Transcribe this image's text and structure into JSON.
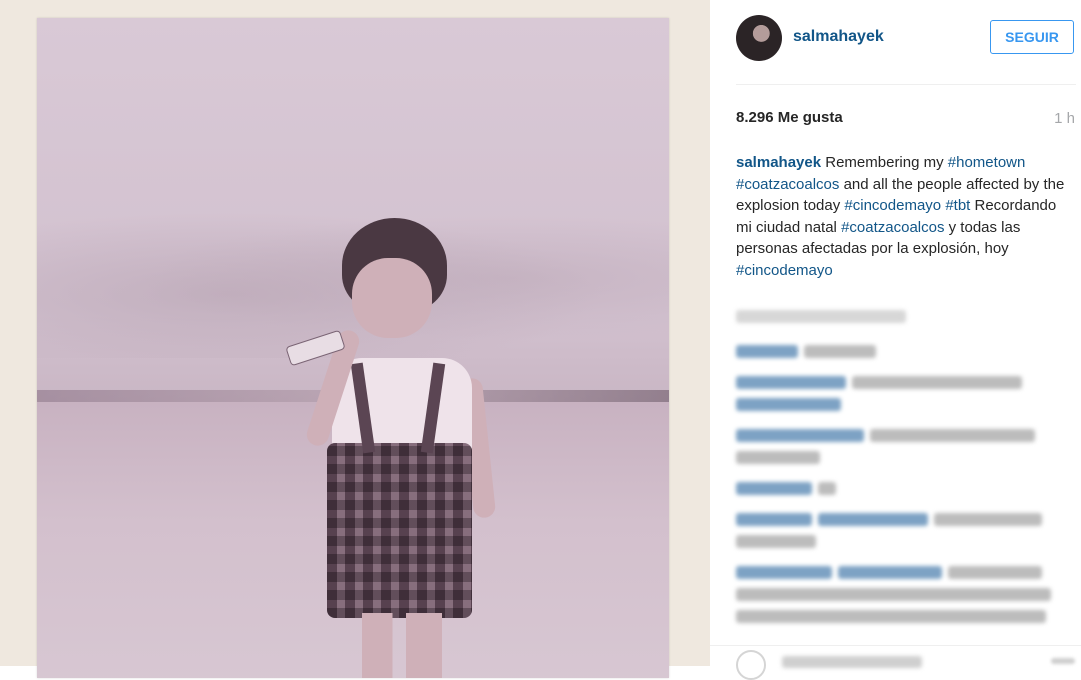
{
  "post": {
    "username": "salmahayek",
    "follow_label": "SEGUIR",
    "likes": "8.296 Me gusta",
    "time": "1 h",
    "caption": {
      "user": "salmahayek",
      "parts": [
        {
          "text": " Remembering my ",
          "tag": false
        },
        {
          "text": "#hometown",
          "tag": true
        },
        {
          "text": " ",
          "tag": false
        },
        {
          "text": "#coatzacoalcos",
          "tag": true
        },
        {
          "text": " and all the people affected by the explosion today ",
          "tag": false
        },
        {
          "text": "#cincodemayo",
          "tag": true
        },
        {
          "text": " ",
          "tag": false
        },
        {
          "text": "#tbt",
          "tag": true
        },
        {
          "text": " Recordando mi ciudad natal ",
          "tag": false
        },
        {
          "text": "#coatzacoalcos",
          "tag": true
        },
        {
          "text": " y todas las personas afectadas por la explosión, hoy ",
          "tag": false
        },
        {
          "text": "#cincodemayo",
          "tag": true
        }
      ]
    }
  },
  "colors": {
    "link": "#125688",
    "follow": "#3897f0",
    "muted": "#a5a7aa"
  },
  "icons": {
    "avatar": "avatar",
    "heart": "heart-icon",
    "more": "more-options-icon"
  }
}
